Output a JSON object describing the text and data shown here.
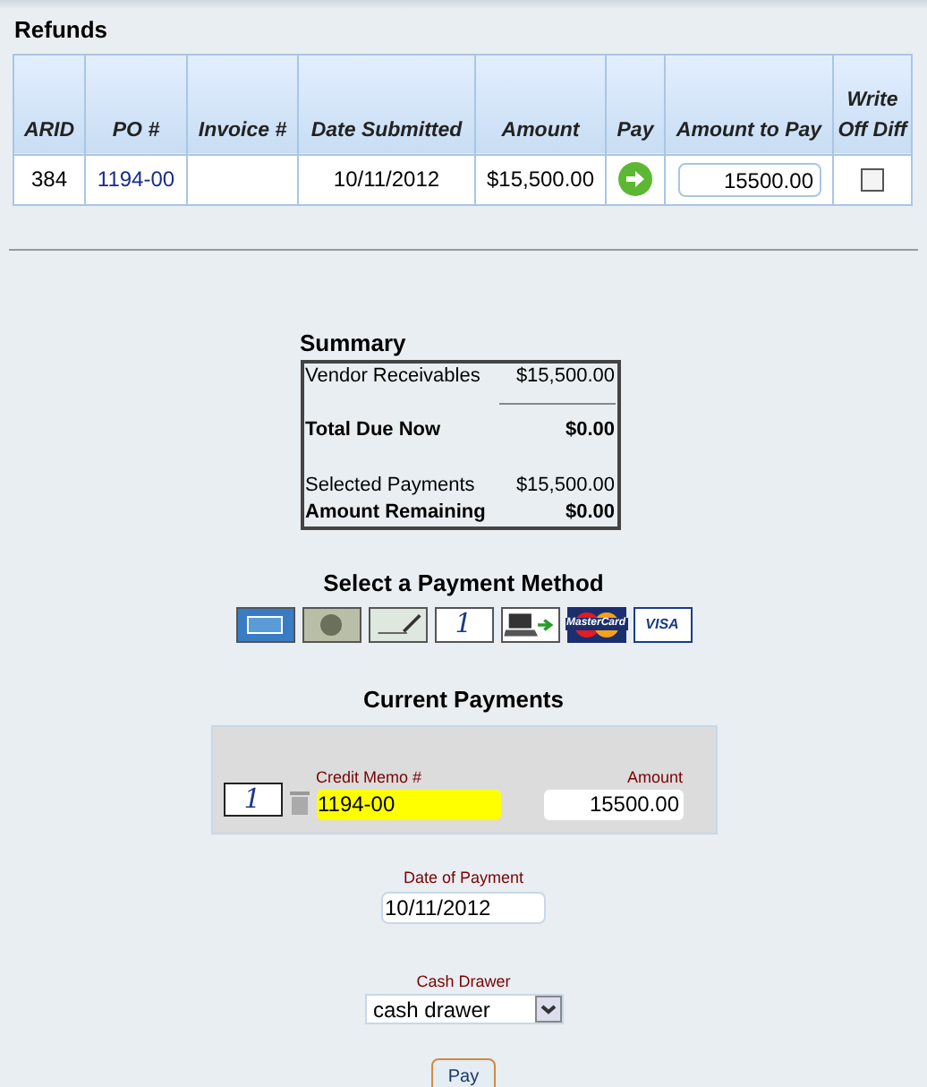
{
  "refunds": {
    "title": "Refunds",
    "columns": [
      "ARID",
      "PO #",
      "Invoice #",
      "Date Submitted",
      "Amount",
      "Pay",
      "Amount to Pay",
      "Write Off Diff"
    ],
    "rows": [
      {
        "arid": "384",
        "po": "1194-00",
        "date_submitted": "10/11/2012",
        "amount": "$15,500.00",
        "amount_to_pay": "15500.00",
        "write_off": false
      }
    ]
  },
  "summary": {
    "title": "Summary",
    "lines": [
      {
        "label": "Vendor Receivables",
        "value": "$15,500.00",
        "bold": false,
        "rule": true
      },
      {
        "label": "Total Due Now",
        "value": "$0.00",
        "bold": true,
        "rule": false
      },
      {
        "label": "Selected Payments",
        "value": "$15,500.00",
        "bold": false,
        "rule": false
      },
      {
        "label": "Amount Remaining",
        "value": "$0.00",
        "bold": true,
        "rule": false
      }
    ]
  },
  "payment_methods": {
    "title": "Select a Payment Method",
    "methods": [
      {
        "kind": "amex"
      },
      {
        "kind": "cash"
      },
      {
        "kind": "check"
      },
      {
        "kind": "memo",
        "label": "1"
      },
      {
        "kind": "electronic"
      },
      {
        "kind": "mastercard",
        "label": "MasterCard"
      },
      {
        "kind": "visa",
        "label": "VISA"
      }
    ]
  },
  "current_payments": {
    "title": "Current Payments",
    "items": [
      {
        "icon_label": "1",
        "memo_label": "Credit Memo #",
        "memo_value": "1194-00",
        "amount_label": "Amount",
        "amount_value": "15500.00"
      }
    ]
  },
  "date_of_payment": {
    "label": "Date of Payment",
    "value": "10/11/2012"
  },
  "cash_drawer": {
    "label": "Cash Drawer",
    "value": "cash drawer"
  },
  "pay_button": "Pay"
}
